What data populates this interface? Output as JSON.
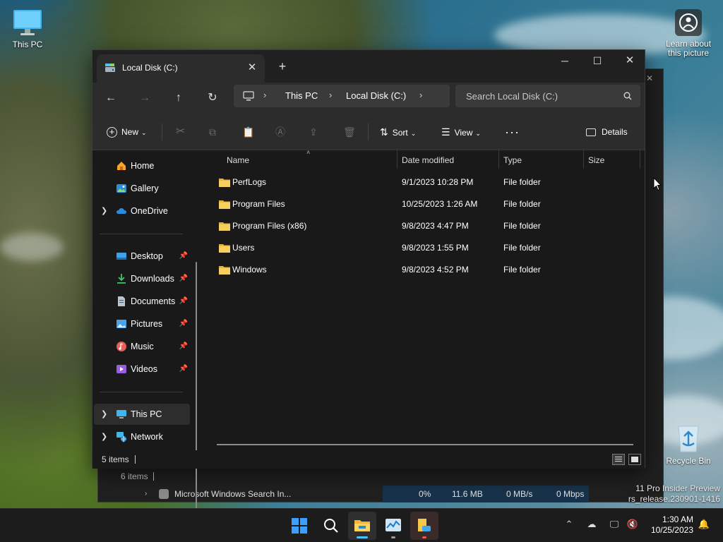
{
  "desktop": {
    "this_pc_label": "This PC",
    "learn_label": "Learn about this picture",
    "recycle_label": "Recycle Bin",
    "watermark_line1": "11 Pro Insider Preview",
    "watermark_line2": "rs_release.230901-1416"
  },
  "background_window": {
    "status_items": "6 items",
    "process_name": "Microsoft Windows Search In...",
    "cpu": "0%",
    "memory": "11.6 MB",
    "disk": "0 MB/s",
    "network": "0 Mbps"
  },
  "explorer": {
    "tab_title": "Local Disk (C:)",
    "breadcrumb": [
      "This PC",
      "Local Disk (C:)"
    ],
    "search_placeholder": "Search Local Disk (C:)",
    "toolbar": {
      "new_label": "New",
      "sort_label": "Sort",
      "view_label": "View",
      "details_label": "Details"
    },
    "sidebar": {
      "home": "Home",
      "gallery": "Gallery",
      "onedrive": "OneDrive",
      "desktop": "Desktop",
      "downloads": "Downloads",
      "documents": "Documents",
      "pictures": "Pictures",
      "music": "Music",
      "videos": "Videos",
      "this_pc": "This PC",
      "network": "Network"
    },
    "columns": [
      "Name",
      "Date modified",
      "Type",
      "Size"
    ],
    "files": [
      {
        "name": "PerfLogs",
        "date": "9/1/2023 10:28 PM",
        "type": "File folder"
      },
      {
        "name": "Program Files",
        "date": "10/25/2023 1:26 AM",
        "type": "File folder"
      },
      {
        "name": "Program Files (x86)",
        "date": "9/8/2023 4:47 PM",
        "type": "File folder"
      },
      {
        "name": "Users",
        "date": "9/8/2023 1:55 PM",
        "type": "File folder"
      },
      {
        "name": "Windows",
        "date": "9/8/2023 4:52 PM",
        "type": "File folder"
      }
    ],
    "status_items": "5 items"
  },
  "taskbar": {
    "time": "1:30 AM",
    "date": "10/25/2023"
  },
  "colors": {
    "accent": "#4cc2ff",
    "folder": "#f2c55c",
    "window_bg": "#191919"
  }
}
